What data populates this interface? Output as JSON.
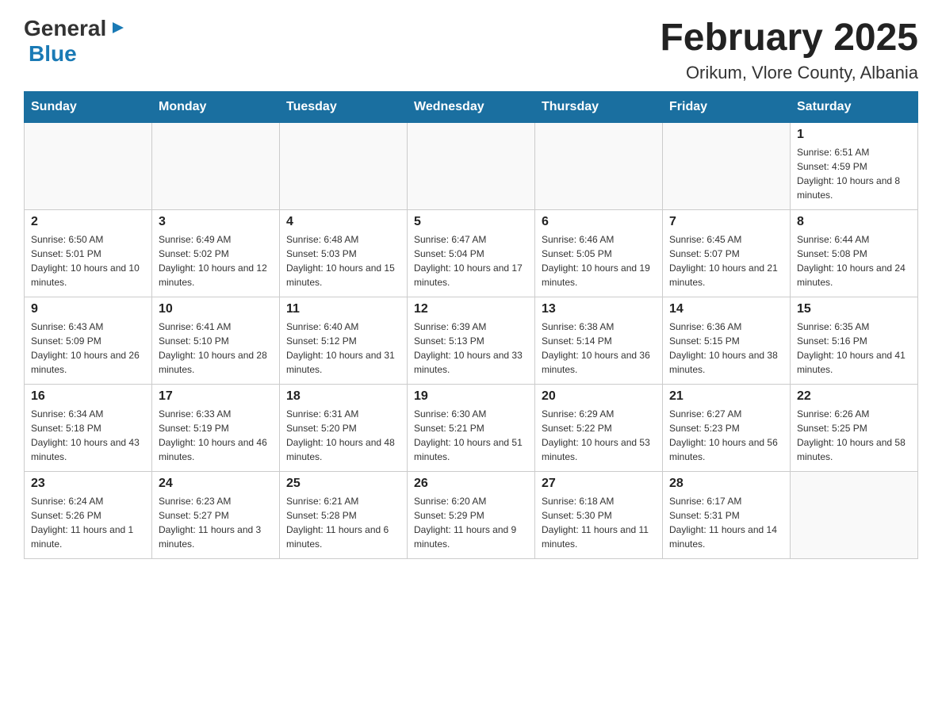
{
  "logo": {
    "general": "General",
    "blue": "Blue",
    "triangle": "▶"
  },
  "title": "February 2025",
  "subtitle": "Orikum, Vlore County, Albania",
  "days_of_week": [
    "Sunday",
    "Monday",
    "Tuesday",
    "Wednesday",
    "Thursday",
    "Friday",
    "Saturday"
  ],
  "weeks": [
    [
      {
        "day": "",
        "info": ""
      },
      {
        "day": "",
        "info": ""
      },
      {
        "day": "",
        "info": ""
      },
      {
        "day": "",
        "info": ""
      },
      {
        "day": "",
        "info": ""
      },
      {
        "day": "",
        "info": ""
      },
      {
        "day": "1",
        "info": "Sunrise: 6:51 AM\nSunset: 4:59 PM\nDaylight: 10 hours and 8 minutes."
      }
    ],
    [
      {
        "day": "2",
        "info": "Sunrise: 6:50 AM\nSunset: 5:01 PM\nDaylight: 10 hours and 10 minutes."
      },
      {
        "day": "3",
        "info": "Sunrise: 6:49 AM\nSunset: 5:02 PM\nDaylight: 10 hours and 12 minutes."
      },
      {
        "day": "4",
        "info": "Sunrise: 6:48 AM\nSunset: 5:03 PM\nDaylight: 10 hours and 15 minutes."
      },
      {
        "day": "5",
        "info": "Sunrise: 6:47 AM\nSunset: 5:04 PM\nDaylight: 10 hours and 17 minutes."
      },
      {
        "day": "6",
        "info": "Sunrise: 6:46 AM\nSunset: 5:05 PM\nDaylight: 10 hours and 19 minutes."
      },
      {
        "day": "7",
        "info": "Sunrise: 6:45 AM\nSunset: 5:07 PM\nDaylight: 10 hours and 21 minutes."
      },
      {
        "day": "8",
        "info": "Sunrise: 6:44 AM\nSunset: 5:08 PM\nDaylight: 10 hours and 24 minutes."
      }
    ],
    [
      {
        "day": "9",
        "info": "Sunrise: 6:43 AM\nSunset: 5:09 PM\nDaylight: 10 hours and 26 minutes."
      },
      {
        "day": "10",
        "info": "Sunrise: 6:41 AM\nSunset: 5:10 PM\nDaylight: 10 hours and 28 minutes."
      },
      {
        "day": "11",
        "info": "Sunrise: 6:40 AM\nSunset: 5:12 PM\nDaylight: 10 hours and 31 minutes."
      },
      {
        "day": "12",
        "info": "Sunrise: 6:39 AM\nSunset: 5:13 PM\nDaylight: 10 hours and 33 minutes."
      },
      {
        "day": "13",
        "info": "Sunrise: 6:38 AM\nSunset: 5:14 PM\nDaylight: 10 hours and 36 minutes."
      },
      {
        "day": "14",
        "info": "Sunrise: 6:36 AM\nSunset: 5:15 PM\nDaylight: 10 hours and 38 minutes."
      },
      {
        "day": "15",
        "info": "Sunrise: 6:35 AM\nSunset: 5:16 PM\nDaylight: 10 hours and 41 minutes."
      }
    ],
    [
      {
        "day": "16",
        "info": "Sunrise: 6:34 AM\nSunset: 5:18 PM\nDaylight: 10 hours and 43 minutes."
      },
      {
        "day": "17",
        "info": "Sunrise: 6:33 AM\nSunset: 5:19 PM\nDaylight: 10 hours and 46 minutes."
      },
      {
        "day": "18",
        "info": "Sunrise: 6:31 AM\nSunset: 5:20 PM\nDaylight: 10 hours and 48 minutes."
      },
      {
        "day": "19",
        "info": "Sunrise: 6:30 AM\nSunset: 5:21 PM\nDaylight: 10 hours and 51 minutes."
      },
      {
        "day": "20",
        "info": "Sunrise: 6:29 AM\nSunset: 5:22 PM\nDaylight: 10 hours and 53 minutes."
      },
      {
        "day": "21",
        "info": "Sunrise: 6:27 AM\nSunset: 5:23 PM\nDaylight: 10 hours and 56 minutes."
      },
      {
        "day": "22",
        "info": "Sunrise: 6:26 AM\nSunset: 5:25 PM\nDaylight: 10 hours and 58 minutes."
      }
    ],
    [
      {
        "day": "23",
        "info": "Sunrise: 6:24 AM\nSunset: 5:26 PM\nDaylight: 11 hours and 1 minute."
      },
      {
        "day": "24",
        "info": "Sunrise: 6:23 AM\nSunset: 5:27 PM\nDaylight: 11 hours and 3 minutes."
      },
      {
        "day": "25",
        "info": "Sunrise: 6:21 AM\nSunset: 5:28 PM\nDaylight: 11 hours and 6 minutes."
      },
      {
        "day": "26",
        "info": "Sunrise: 6:20 AM\nSunset: 5:29 PM\nDaylight: 11 hours and 9 minutes."
      },
      {
        "day": "27",
        "info": "Sunrise: 6:18 AM\nSunset: 5:30 PM\nDaylight: 11 hours and 11 minutes."
      },
      {
        "day": "28",
        "info": "Sunrise: 6:17 AM\nSunset: 5:31 PM\nDaylight: 11 hours and 14 minutes."
      },
      {
        "day": "",
        "info": ""
      }
    ]
  ]
}
